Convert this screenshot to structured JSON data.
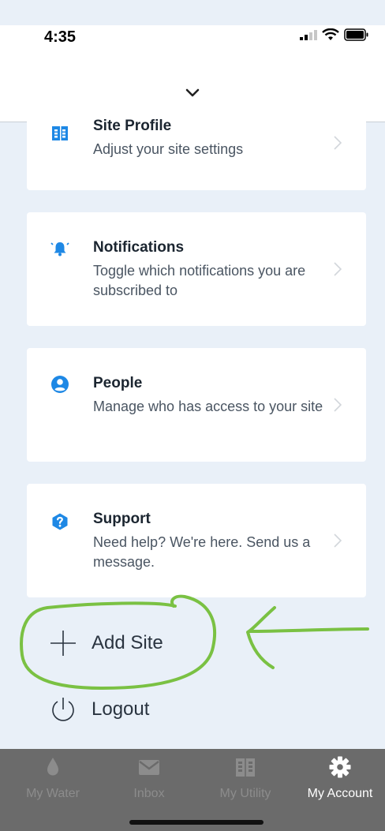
{
  "status_bar": {
    "time": "4:35"
  },
  "sheet": {
    "collapse_icon": "chevron-down-icon"
  },
  "menu": [
    {
      "key": "site-profile",
      "icon": "building-icon",
      "title": "Site Profile",
      "description": "Adjust your site settings"
    },
    {
      "key": "notifications",
      "icon": "bell-icon",
      "title": "Notifications",
      "description": "Toggle which notifications you are subscribed to"
    },
    {
      "key": "people",
      "icon": "person-icon",
      "title": "People",
      "description": "Manage who has access to your site"
    },
    {
      "key": "support",
      "icon": "help-icon",
      "title": "Support",
      "description": "Need help? We're here. Send us a message."
    }
  ],
  "actions": {
    "add_site": "Add Site",
    "logout": "Logout"
  },
  "tabs": [
    {
      "label": "My Water",
      "icon": "water-drop-icon",
      "active": false
    },
    {
      "label": "Inbox",
      "icon": "mail-icon",
      "active": false
    },
    {
      "label": "My Utility",
      "icon": "building-icon",
      "active": false
    },
    {
      "label": "My Account",
      "icon": "gear-icon",
      "active": true
    }
  ],
  "colors": {
    "accent": "#1e88e5",
    "background": "#e9f0f8",
    "tab_bar": "#6b6b6b",
    "annotation": "#7ac143"
  }
}
